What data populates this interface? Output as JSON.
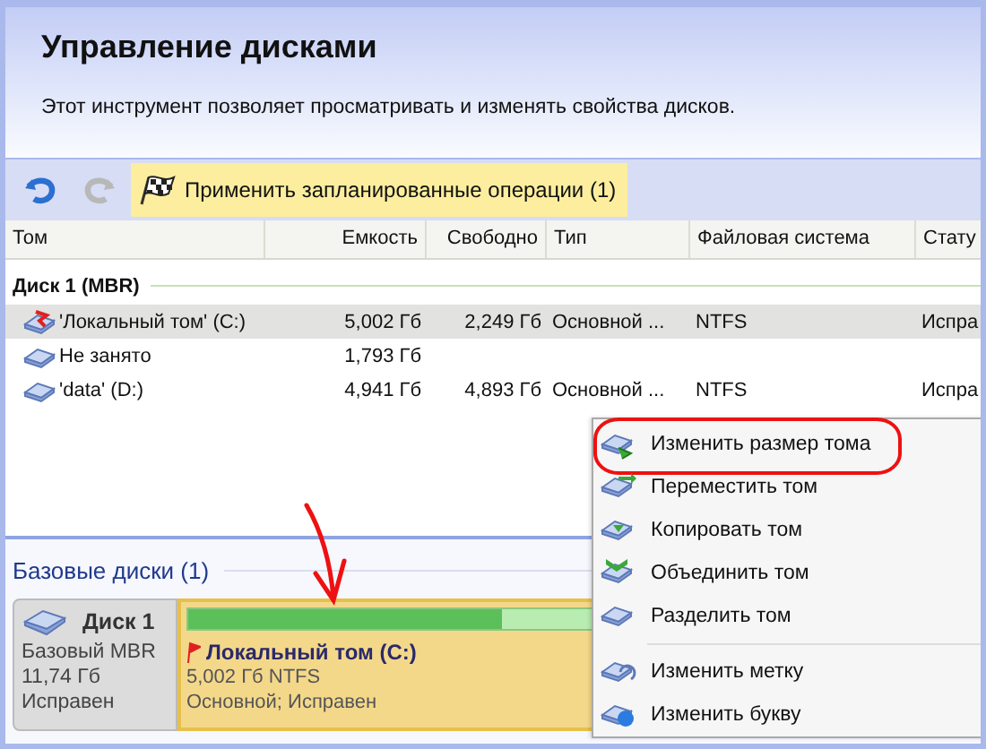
{
  "header": {
    "title": "Управление дисками",
    "description": "Этот инструмент позволяет просматривать и изменять свойства дисков."
  },
  "toolbar": {
    "buttons": [
      {
        "kind": "undo",
        "disabled": false
      },
      {
        "kind": "redo",
        "disabled": true
      }
    ],
    "apply_button": "Применить запланированные операции (1)"
  },
  "table": {
    "columns": [
      "Том",
      "Емкость",
      "Свободно",
      "Тип",
      "Файловая система",
      "Стату"
    ],
    "group": "Диск 1 (MBR)",
    "rows": [
      {
        "name": "'Локальный том' (C:)",
        "capacity": "5,002 Гб",
        "free": "2,249 Гб",
        "type": "Основной ...",
        "fs": "NTFS",
        "status": "Испра",
        "selected": true,
        "pending": true
      },
      {
        "name": "Не занято",
        "capacity": "1,793 Гб",
        "free": "",
        "type": "",
        "fs": "",
        "status": "",
        "selected": false,
        "pending": false
      },
      {
        "name": "'data' (D:)",
        "capacity": "4,941 Гб",
        "free": "4,893 Гб",
        "type": "Основной ...",
        "fs": "NTFS",
        "status": "Испра",
        "selected": false,
        "pending": false
      }
    ]
  },
  "disks_panel": {
    "title": "Базовые диски (1)",
    "disk": {
      "name": "Диск 1",
      "type": "Базовый MBR",
      "size": "11,74 Гб",
      "status": "Исправен"
    },
    "partition": {
      "name": "Локальный том (C:)",
      "details": "5,002 Гб NTFS",
      "status": "Основной; Исправен",
      "level": 0.55,
      "pending": true
    }
  },
  "context_menu": {
    "groups": [
      [
        {
          "label": "Изменить размер тома",
          "kind": "resize",
          "circled": true
        },
        {
          "label": "Переместить том",
          "kind": "move",
          "circled": false
        },
        {
          "label": "Копировать том",
          "kind": "copy",
          "circled": false
        },
        {
          "label": "Объединить том",
          "kind": "merge",
          "circled": false
        },
        {
          "label": "Разделить том",
          "kind": "split",
          "circled": false
        }
      ],
      [
        {
          "label": "Изменить метку",
          "kind": "label",
          "circled": false
        },
        {
          "label": "Изменить букву",
          "kind": "letter",
          "circled": false
        }
      ]
    ]
  }
}
